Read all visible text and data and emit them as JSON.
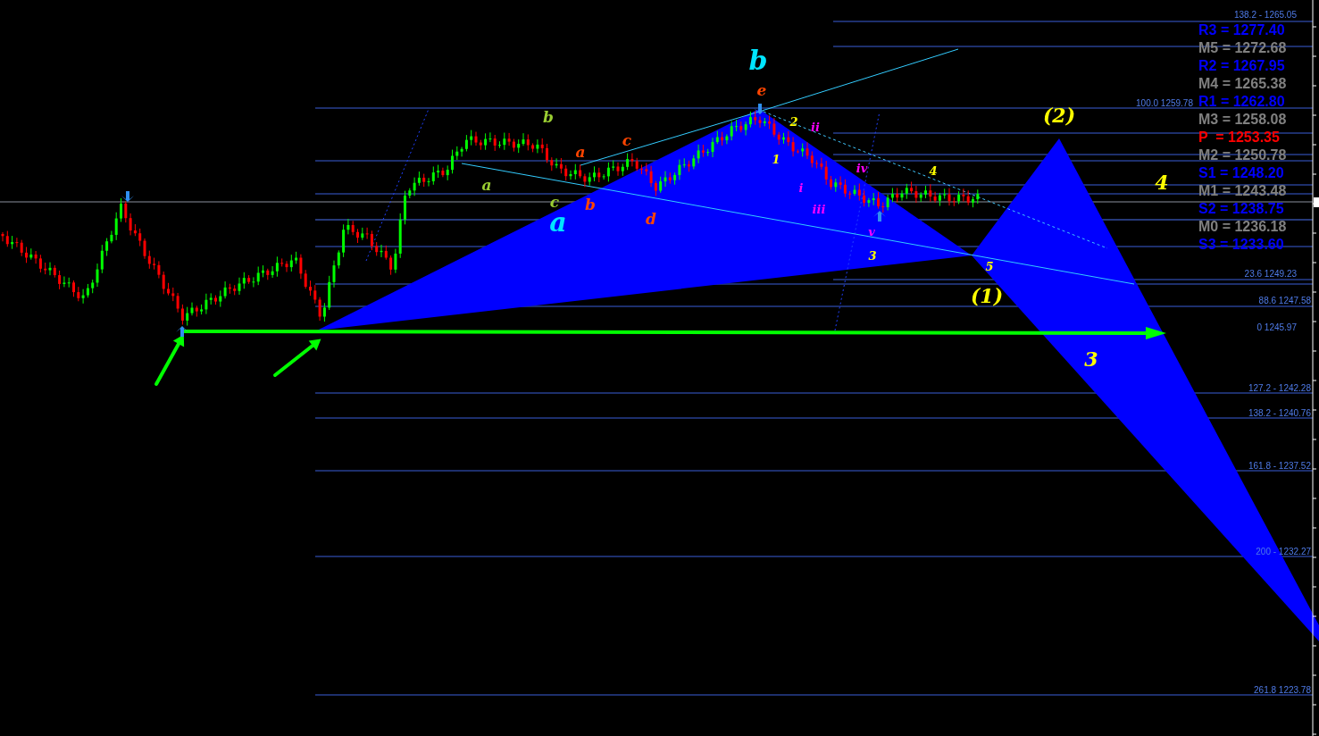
{
  "chart": {
    "pivot_levels": [
      {
        "text": "R3 = 1277.40",
        "color": "#0000ff"
      },
      {
        "text": "M5 = 1272.68",
        "color": "#808080"
      },
      {
        "text": "R2 = 1267.95",
        "color": "#0000ff"
      },
      {
        "text": "M4 = 1265.38",
        "color": "#808080"
      },
      {
        "text": "R1 = 1262.80",
        "color": "#0000ff"
      },
      {
        "text": "M3 = 1258.08",
        "color": "#808080"
      },
      {
        "text": "P  = 1253.35",
        "color": "#ff0000"
      },
      {
        "text": "M2 = 1250.78",
        "color": "#808080"
      },
      {
        "text": "S1 = 1248.20",
        "color": "#0000ff"
      },
      {
        "text": "M1 = 1243.48",
        "color": "#808080"
      },
      {
        "text": "S2 = 1238.75",
        "color": "#0000ff"
      },
      {
        "text": "M0 = 1236.18",
        "color": "#808080"
      },
      {
        "text": "S3 = 1233.60",
        "color": "#0000ff"
      }
    ],
    "fib_levels": [
      {
        "text": "138.2 - 1265.05"
      },
      {
        "text": "100.0 1259.78"
      },
      {
        "text": "23.6 1249.23"
      },
      {
        "text": "88.6 1247.58"
      },
      {
        "text": "0 1245.97"
      },
      {
        "text": "127.2 - 1242.28"
      },
      {
        "text": "138.2 - 1240.76"
      },
      {
        "text": "161.8 - 1237.52"
      },
      {
        "text": "200 - 1232.27"
      },
      {
        "text": "261.8 1223.78"
      }
    ],
    "wave_labels": [
      {
        "text": "b",
        "color": "#00e5ff",
        "kind": "large"
      },
      {
        "text": "a",
        "color": "#00e5ff",
        "kind": "large"
      },
      {
        "text": "b",
        "color": "#9acd32",
        "kind": "small"
      },
      {
        "text": "a",
        "color": "#9acd32",
        "kind": "small"
      },
      {
        "text": "c",
        "color": "#9acd32",
        "kind": "small"
      },
      {
        "text": "a",
        "color": "#ff4500",
        "kind": "small"
      },
      {
        "text": "c",
        "color": "#ff4500",
        "kind": "small"
      },
      {
        "text": "b",
        "color": "#ff4500",
        "kind": "small"
      },
      {
        "text": "d",
        "color": "#ff4500",
        "kind": "small"
      },
      {
        "text": "e",
        "color": "#ff4500",
        "kind": "small"
      },
      {
        "text": "1",
        "color": "#ffff00",
        "kind": "tiny"
      },
      {
        "text": "2",
        "color": "#ffff00",
        "kind": "tiny"
      },
      {
        "text": "3",
        "color": "#ffff00",
        "kind": "tiny"
      },
      {
        "text": "4",
        "color": "#ffff00",
        "kind": "tiny"
      },
      {
        "text": "5",
        "color": "#ffff00",
        "kind": "tiny"
      },
      {
        "text": "i",
        "color": "#ff00ff",
        "kind": "tiny"
      },
      {
        "text": "ii",
        "color": "#ff00ff",
        "kind": "tiny"
      },
      {
        "text": "iii",
        "color": "#ff00ff",
        "kind": "tiny"
      },
      {
        "text": "iv",
        "color": "#ff00ff",
        "kind": "tiny"
      },
      {
        "text": "v",
        "color": "#ff00ff",
        "kind": "tiny"
      },
      {
        "text": "(2)",
        "color": "#ffff00",
        "kind": "medium"
      },
      {
        "text": "(1)",
        "color": "#ffff00",
        "kind": "medium"
      },
      {
        "text": "4",
        "color": "#ffff00",
        "kind": "medium"
      },
      {
        "text": "3",
        "color": "#ffff00",
        "kind": "medium"
      }
    ]
  }
}
